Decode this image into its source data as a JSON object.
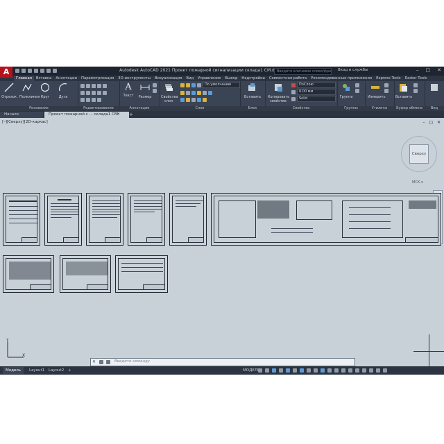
{
  "app": {
    "logo": "A",
    "title": "Autodesk AutoCAD 2021   Проект пожарной сигнализации склада1 СМ.dwg",
    "search_placeholder": "Введите ключевое слово/фразу",
    "signin": "Вход в службы",
    "window_controls": [
      "–",
      "□",
      "✕"
    ]
  },
  "ribbon_tabs": [
    "Главная",
    "Вставка",
    "Аннотации",
    "Параметризация",
    "3D-инструменты",
    "Визуализация",
    "Вид",
    "Управление",
    "Вывод",
    "Надстройки",
    "Совместная работа",
    "Рекомендованные приложения",
    "Express Tools",
    "Raster Tools"
  ],
  "ribbon": {
    "draw": {
      "title": "Рисование",
      "buttons": [
        "Отрезок",
        "Полилиния",
        "Круг",
        "Дуга"
      ]
    },
    "modify": {
      "title": "Редактирование"
    },
    "annotation": {
      "title": "Аннотации",
      "buttons": [
        "Текст",
        "Размер"
      ]
    },
    "layers": {
      "title": "Слои",
      "button": "Свойства слоя",
      "combo": "По умолчанию"
    },
    "blocks": {
      "title": "Блок",
      "button": "Вставить"
    },
    "properties": {
      "title": "Свойства",
      "button": "Копировать свойства",
      "color": "ПоСлою",
      "lineweight": "0.00 мм",
      "linetype": "Solid"
    },
    "groups": {
      "title": "Группы",
      "button": "Группа"
    },
    "utilities": {
      "title": "Утилиты",
      "button": "Измерить"
    },
    "clipboard": {
      "title": "Буфер обмена",
      "button": "Вставить"
    },
    "view": {
      "title": "Вид"
    }
  },
  "file_tabs": {
    "start": "Начало",
    "doc": "Проект пожарной с ... склада1 СМ",
    "close": "✕",
    "new": "+"
  },
  "viewport": {
    "label": "[–][Сверху][2D-каркас]",
    "controls": "– □ ✕",
    "viewcube": "Сверху",
    "wcs": "МСК ▾"
  },
  "ucs": {
    "x": "X",
    "y": "Y"
  },
  "command": {
    "close": "✕",
    "placeholder": "Введите команду"
  },
  "status": {
    "tabs": [
      "Модель",
      "Layout1",
      "Layout2"
    ],
    "plus": "+",
    "model": "МОДЕЛЬ"
  },
  "colors": {
    "titlebar": "#1e2530",
    "ribbon": "#3b4454",
    "canvas": "#c8d0d8",
    "logo": "#b5121b",
    "accent": "#5b9bd5"
  }
}
